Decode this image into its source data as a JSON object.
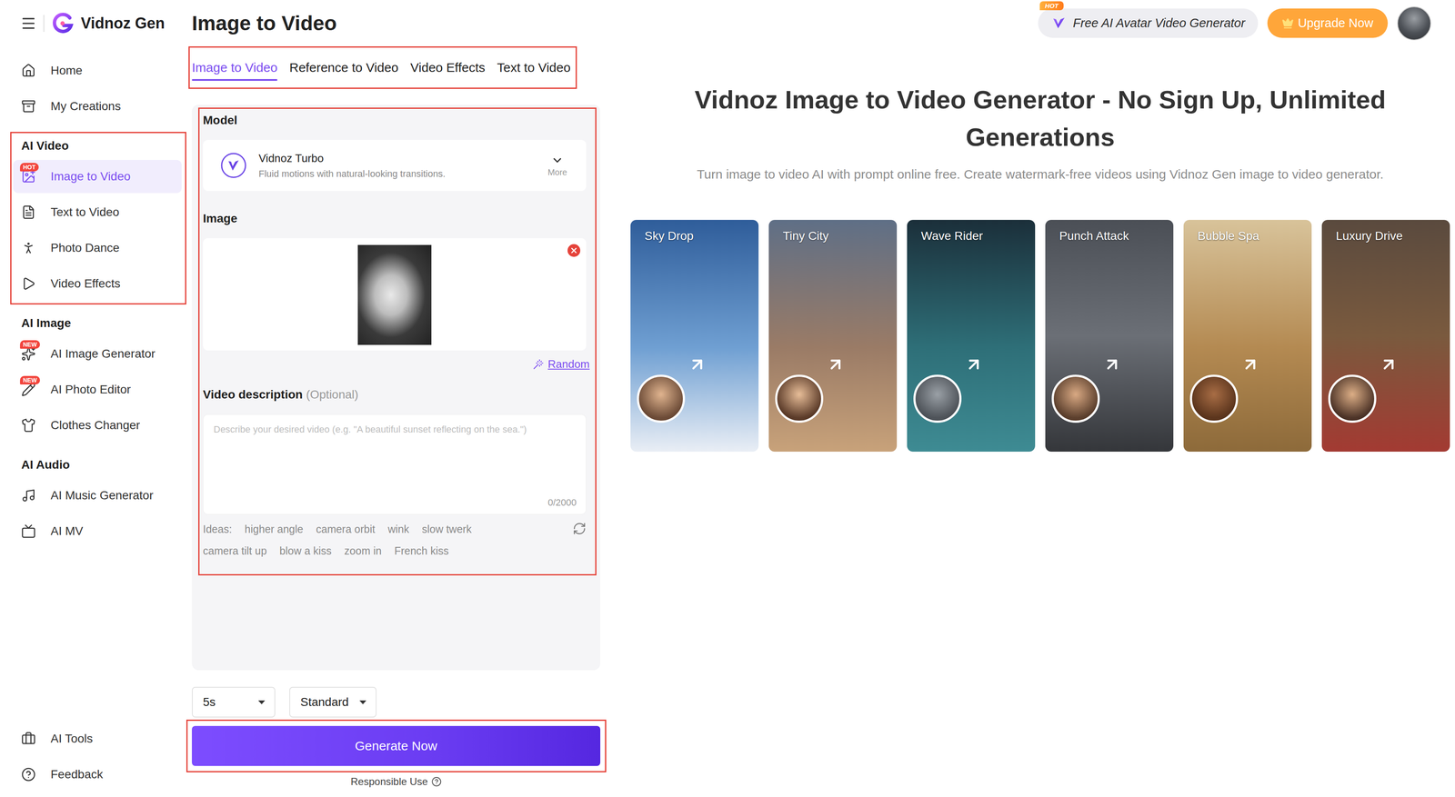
{
  "logo": {
    "text": "Vidnoz Gen"
  },
  "sidebar": {
    "top": [
      {
        "label": "Home",
        "selected": false
      },
      {
        "label": "My Creations",
        "selected": false
      }
    ],
    "sections": [
      {
        "title": "AI Video",
        "outlined": true,
        "items": [
          {
            "label": "Image to Video",
            "selected": true,
            "badge": "HOT"
          },
          {
            "label": "Text to Video",
            "selected": false
          },
          {
            "label": "Photo Dance",
            "selected": false
          },
          {
            "label": "Video Effects",
            "selected": false
          }
        ]
      },
      {
        "title": "AI Image",
        "outlined": false,
        "items": [
          {
            "label": "AI Image Generator",
            "selected": false,
            "badge": "NEW"
          },
          {
            "label": "AI Photo Editor",
            "selected": false,
            "badge": "NEW"
          },
          {
            "label": "Clothes Changer",
            "selected": false
          }
        ]
      },
      {
        "title": "AI Audio",
        "outlined": false,
        "items": [
          {
            "label": "AI Music Generator",
            "selected": false
          },
          {
            "label": "AI MV",
            "selected": false
          }
        ]
      }
    ],
    "bottom": [
      {
        "label": "AI Tools",
        "selected": false
      },
      {
        "label": "Feedback",
        "selected": false
      }
    ]
  },
  "header": {
    "title": "Image to Video",
    "promo_badge": "HOT",
    "promo": "Free AI Avatar Video Generator",
    "upgrade": "Upgrade Now"
  },
  "tabs": {
    "outlined": true,
    "items": [
      {
        "label": "Image to Video",
        "selected": true
      },
      {
        "label": "Reference to Video",
        "selected": false
      },
      {
        "label": "Video Effects",
        "selected": false
      },
      {
        "label": "Text to Video",
        "selected": false
      }
    ]
  },
  "form": {
    "outlined": true,
    "model": {
      "label": "Model",
      "name": "Vidnoz Turbo",
      "description": "Fluid motions with natural-looking transitions.",
      "more": "More"
    },
    "image": {
      "label": "Image",
      "random": "Random"
    },
    "description": {
      "label": "Video description",
      "optional": "(Optional)",
      "placeholder": "Describe your desired video (e.g. \"A beautiful sunset reflecting on the sea.\")",
      "count": "0/2000"
    },
    "ideas": {
      "label": "Ideas:",
      "items": [
        "higher angle",
        "camera orbit",
        "wink",
        "slow twerk",
        "camera tilt up",
        "blow a kiss",
        "zoom in",
        "French kiss"
      ]
    }
  },
  "controls": {
    "duration": "5s",
    "quality": "Standard",
    "generate": "Generate Now",
    "generate_outlined": true,
    "responsible": "Responsible Use"
  },
  "hero": {
    "title": "Vidnoz Image to Video Generator - No Sign Up, Unlimited Generations",
    "subtitle": "Turn image to video AI with prompt online free. Create watermark-free videos using Vidnoz Gen image to video generator."
  },
  "examples": [
    {
      "label": "Sky Drop"
    },
    {
      "label": "Tiny City"
    },
    {
      "label": "Wave Rider"
    },
    {
      "label": "Punch Attack"
    },
    {
      "label": "Bubble Spa"
    },
    {
      "label": "Luxury Drive"
    }
  ]
}
